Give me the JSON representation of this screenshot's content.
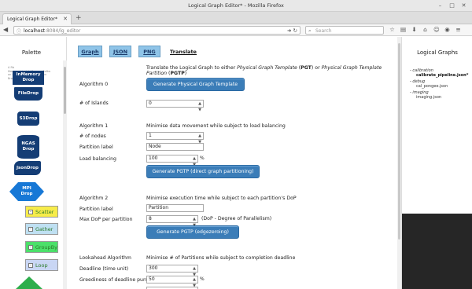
{
  "window": {
    "title": "Logical Graph Editor* - Mozilla Firefox",
    "buttons": [
      "–",
      "□",
      "✕"
    ]
  },
  "tab": {
    "label": "Logical Graph Editor*",
    "close": "✕",
    "new": "+"
  },
  "nav": {
    "url_host": "localhost",
    "url_path": ":8084/lg_editor",
    "search_placeholder": "Search"
  },
  "palette": {
    "title": "Palette",
    "tiny_text": [
      "A Rb ",
      "Memory block InMemory Softw",
      "on Sand MRV DB production ",
      "Bra.. Iteration"
    ],
    "nodes": {
      "inmemory": "InMemory\nDrop",
      "file": "FileDrop",
      "s3": "S3Drop",
      "ngas": "NGAS\nDrop",
      "json": "JsonDrop",
      "mpi": "MPI\nDrop"
    },
    "constructs": {
      "scatter": "Scatter",
      "gather": "Gather",
      "groupby": "GroupBy",
      "loop": "Loop",
      "square_glyph": "–"
    }
  },
  "toptabs": {
    "graph": "Graph",
    "json": "JSON",
    "png": "PNG",
    "translate": "Translate"
  },
  "translate": {
    "intro_pre": "Translate the Logical Graph to either ",
    "intro_pgt": "Physical Graph Template",
    "intro_pgt_abbr": "PGT",
    "intro_mid": " or ",
    "intro_pgtp": "Physical Graph Template Partition",
    "intro_pgtp_abbr": "PGTP",
    "algo0": {
      "label": "Algorithm 0",
      "button": "Generate Physical Graph Template",
      "islands_label": "# of Islands",
      "islands_value": "0"
    },
    "algo1": {
      "label": "Algorithm 1",
      "desc": "Minimise data movement while subject to load balancing",
      "nodes_label": "# of nodes",
      "nodes_value": "1",
      "partition_label": "Partition label",
      "partition_value": "Node",
      "load_label": "Load balancing",
      "load_value": "100",
      "load_unit": "%",
      "button": "Generate PGTP (direct graph partitioning)"
    },
    "algo2": {
      "label": "Algorithm 2",
      "desc": "Minimise execution time while subject to each partition's DoP",
      "partition_label": "Partition label",
      "partition_value": "Partition",
      "dop_label": "Max DoP per partition",
      "dop_value": "8",
      "dop_note": "(DoP - Degree of Parallelism)",
      "button": "Generate PGTP (edgezeroing)"
    },
    "lookahead": {
      "label": "Lookahead Algorithm",
      "desc": "Minimise # of Partitions while subject to completion deadline",
      "deadline_label": "Deadline (time unit)",
      "deadline_value": "300",
      "greedy_label": "Greediness of deadline pursue",
      "greedy_value": "50",
      "greedy_unit": "%"
    }
  },
  "logical_graphs": {
    "title": "Logical Graphs",
    "groups": [
      {
        "category": "calibration",
        "files": [
          {
            "name": "calibrate_pipeline.json*",
            "bold": true
          }
        ]
      },
      {
        "category": "debug",
        "files": [
          {
            "name": "cal_pongee.json",
            "bold": false
          }
        ]
      },
      {
        "category": "imaging",
        "files": [
          {
            "name": "imaging.json",
            "bold": false
          }
        ]
      }
    ]
  },
  "colors": {
    "drop_dark": "#143d75",
    "mpi_blue": "#1778d6",
    "button_blue": "#3b7db8",
    "tab_blue": "#8fc4e8"
  }
}
